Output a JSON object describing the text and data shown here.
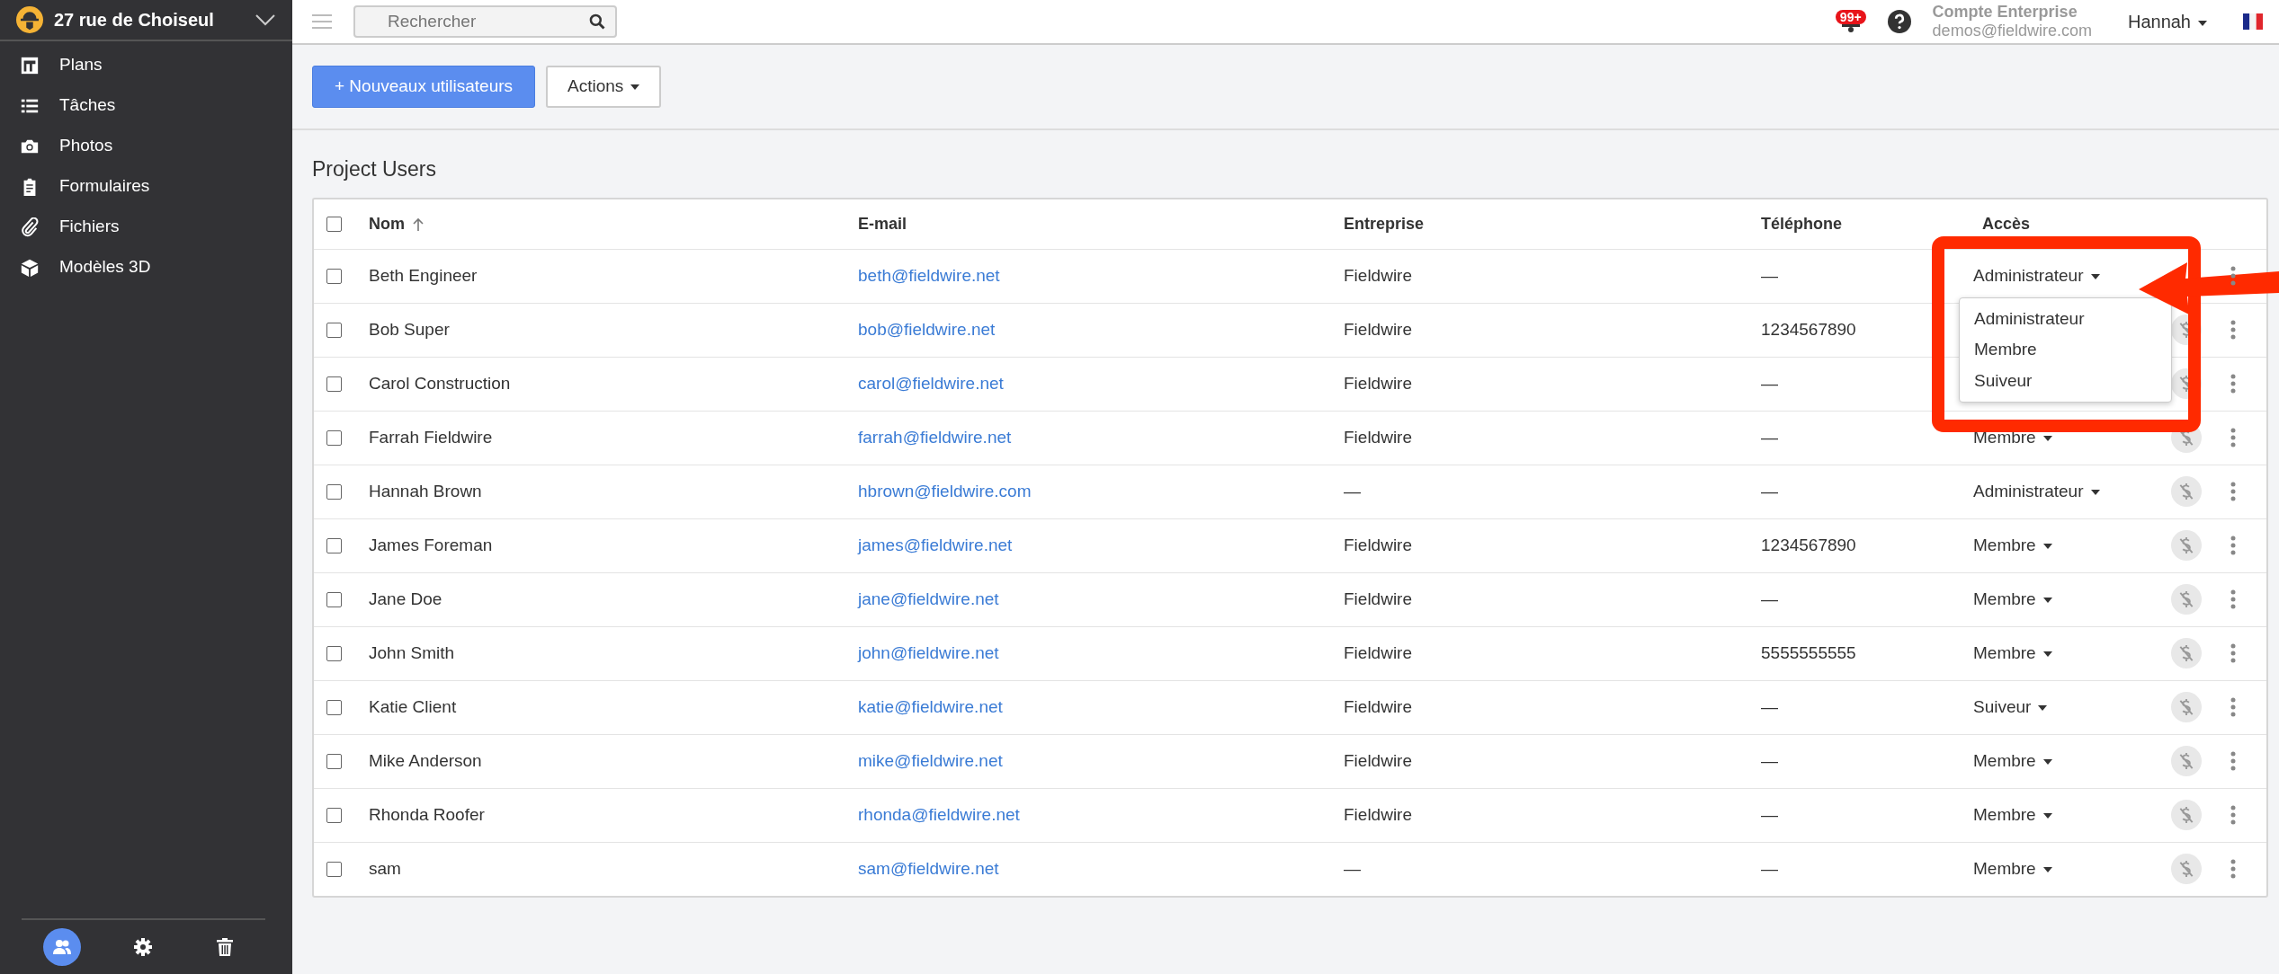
{
  "sidebar": {
    "project": "27 rue de Choiseul",
    "items": [
      {
        "label": "Plans"
      },
      {
        "label": "Tâches"
      },
      {
        "label": "Photos"
      },
      {
        "label": "Formulaires"
      },
      {
        "label": "Fichiers"
      },
      {
        "label": "Modèles 3D"
      }
    ],
    "footer": [
      {
        "kind": "users",
        "selected": true
      },
      {
        "kind": "settings",
        "selected": false
      },
      {
        "kind": "trash",
        "selected": false
      }
    ]
  },
  "topbar": {
    "search": {
      "placeholder": "Rechercher"
    },
    "notifications": "99+",
    "account": {
      "title": "Compte Enterprise",
      "email": "demos@fieldwire.com"
    },
    "user": "Hannah"
  },
  "toolbar": {
    "buttons": [
      {
        "label": "+ Nouveaux utilisateurs",
        "kind": "primary"
      },
      {
        "label": "Actions",
        "kind": "dropdown"
      }
    ]
  },
  "section_title": "Project Users",
  "table": {
    "select_all_checked": false,
    "columns": [
      {
        "label": "Nom",
        "sorted": true
      },
      {
        "label": "E-mail",
        "sorted": false
      },
      {
        "label": "Entreprise",
        "sorted": false
      },
      {
        "label": "Téléphone",
        "sorted": false
      },
      {
        "label": "Accès",
        "sorted": false
      }
    ],
    "rows": [
      {
        "name": "Beth Engineer",
        "email": "beth@fieldwire.net",
        "company": "Fieldwire",
        "phone": "—",
        "access": "Administrateur",
        "billing_icon": false,
        "checked": false,
        "access_menu": {
          "options": [
            "Administrateur",
            "Membre",
            "Suiveur"
          ]
        }
      },
      {
        "name": "Bob Super",
        "email": "bob@fieldwire.net",
        "company": "Fieldwire",
        "phone": "1234567890",
        "billing_icon": true,
        "checked": false
      },
      {
        "name": "Carol Construction",
        "email": "carol@fieldwire.net",
        "company": "Fieldwire",
        "phone": "—",
        "billing_icon": true,
        "checked": false
      },
      {
        "name": "Farrah Fieldwire",
        "email": "farrah@fieldwire.net",
        "company": "Fieldwire",
        "phone": "—",
        "access": "Membre",
        "billing_icon": true,
        "checked": false
      },
      {
        "name": "Hannah Brown",
        "email": "hbrown@fieldwire.com",
        "company": "—",
        "phone": "—",
        "access": "Administrateur",
        "billing_icon": true,
        "checked": false
      },
      {
        "name": "James Foreman",
        "email": "james@fieldwire.net",
        "company": "Fieldwire",
        "phone": "1234567890",
        "access": "Membre",
        "billing_icon": true,
        "checked": false
      },
      {
        "name": "Jane Doe",
        "email": "jane@fieldwire.net",
        "company": "Fieldwire",
        "phone": "—",
        "access": "Membre",
        "billing_icon": true,
        "checked": false
      },
      {
        "name": "John Smith",
        "email": "john@fieldwire.net",
        "company": "Fieldwire",
        "phone": "5555555555",
        "access": "Membre",
        "billing_icon": true,
        "checked": false
      },
      {
        "name": "Katie Client",
        "email": "katie@fieldwire.net",
        "company": "Fieldwire",
        "phone": "—",
        "access": "Suiveur",
        "billing_icon": true,
        "checked": false
      },
      {
        "name": "Mike Anderson",
        "email": "mike@fieldwire.net",
        "company": "Fieldwire",
        "phone": "—",
        "access": "Membre",
        "billing_icon": true,
        "checked": false
      },
      {
        "name": "Rhonda Roofer",
        "email": "rhonda@fieldwire.net",
        "company": "Fieldwire",
        "phone": "—",
        "access": "Membre",
        "billing_icon": true,
        "checked": false
      },
      {
        "name": "sam",
        "email": "sam@fieldwire.net",
        "company": "—",
        "phone": "—",
        "access": "Membre",
        "billing_icon": true,
        "checked": false
      }
    ]
  }
}
